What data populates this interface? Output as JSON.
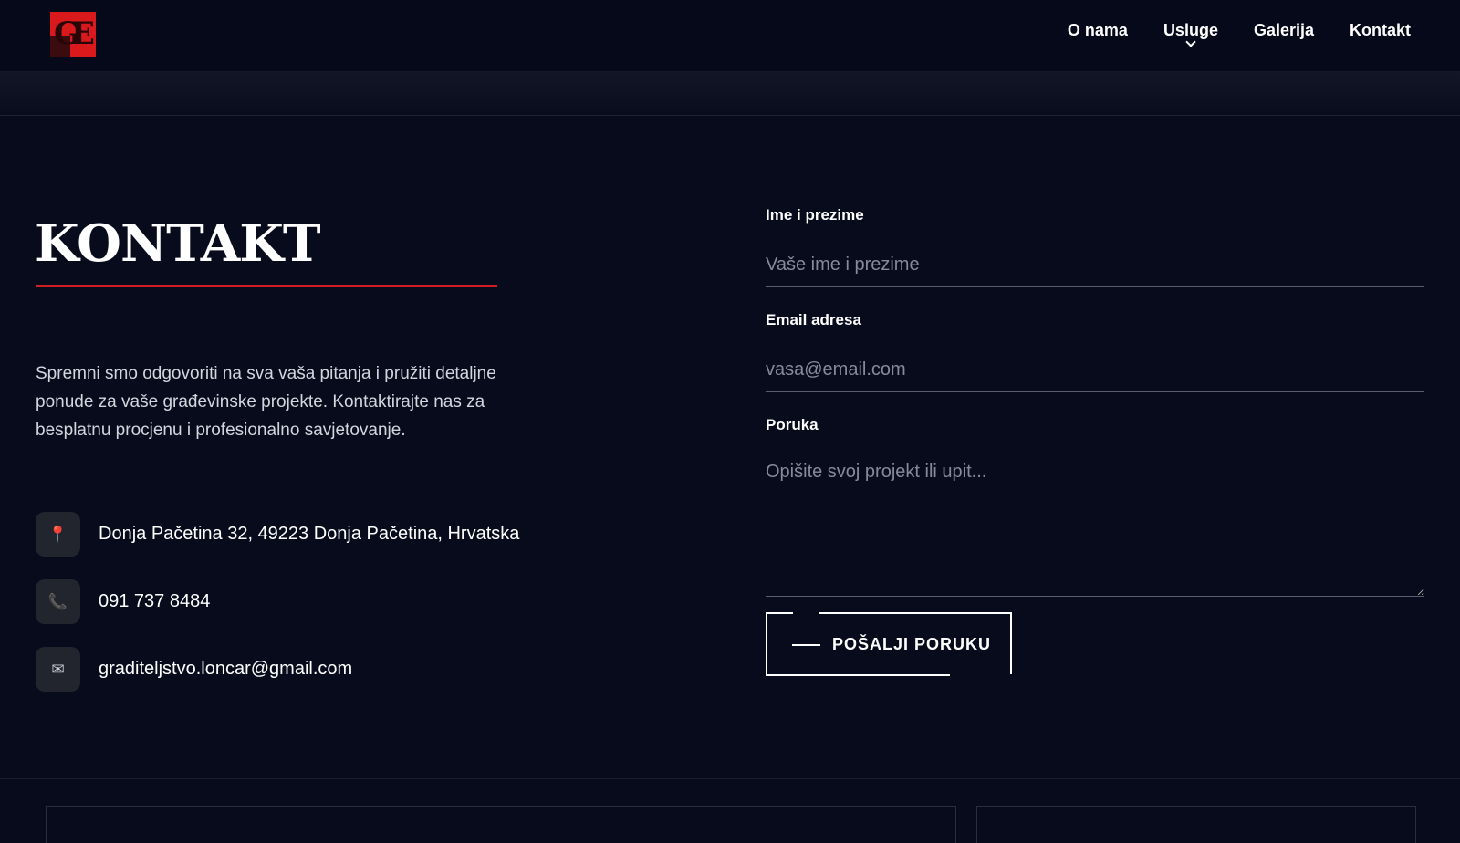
{
  "header": {
    "logo_alt": "Graditeljstvo Lončar logo",
    "nav": [
      {
        "label": "O nama"
      },
      {
        "label": "Usluge"
      },
      {
        "label": "Galerija"
      },
      {
        "label": "Kontakt"
      }
    ]
  },
  "contact": {
    "title": "KONTAKT",
    "intro": "Spremni smo odgovoriti na sva vaša pitanja i pružiti detaljne ponude za vaše građevinske projekte. Kontaktirajte nas za besplatnu procjenu i profesionalno savjetovanje.",
    "address": {
      "icon": "map-pin-icon",
      "glyph": "📍",
      "text": "Donja Pačetina 32, 49223 Donja Pačetina, Hrvatska"
    },
    "phone": {
      "icon": "phone-icon",
      "glyph": "📞",
      "text": "091 737 8484"
    },
    "email": {
      "icon": "envelope-icon",
      "glyph": "✉",
      "text": "graditeljstvo.loncar@gmail.com"
    }
  },
  "form": {
    "name_label": "Ime i prezime",
    "name_placeholder": "Vaše ime i prezime",
    "name_value": "",
    "email_label": "Email adresa",
    "email_placeholder": "vasa@email.com",
    "email_value": "",
    "message_label": "Poruka",
    "message_placeholder": "Opišite svoj projekt ili upit...",
    "message_value": "",
    "submit_label": "POŠALJI PORUKU"
  },
  "colors": {
    "background": "#070b1b",
    "header": "#050919",
    "accent": "#cf1d22",
    "text": "#ffffff",
    "muted_text": "#d3d6de",
    "placeholder": "#868b99",
    "icon_bg": "#23252e"
  }
}
